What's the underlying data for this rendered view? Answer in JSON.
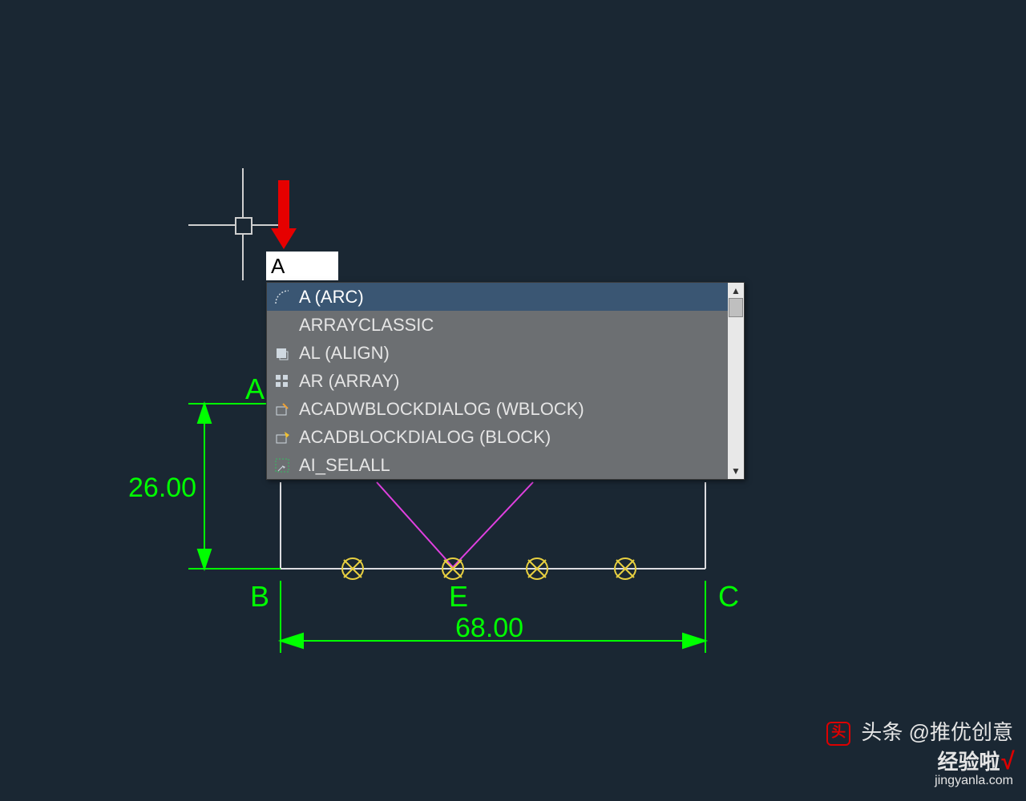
{
  "command_input": "A",
  "dropdown": {
    "items": [
      {
        "label": "A (ARC)",
        "icon": "arc-icon",
        "selected": true
      },
      {
        "label": "ARRAYCLASSIC",
        "icon": "",
        "selected": false
      },
      {
        "label": "AL (ALIGN)",
        "icon": "align-icon",
        "selected": false
      },
      {
        "label": "AR (ARRAY)",
        "icon": "array-icon",
        "selected": false
      },
      {
        "label": "ACADWBLOCKDIALOG (WBLOCK)",
        "icon": "wblock-icon",
        "selected": false
      },
      {
        "label": "ACADBLOCKDIALOG (BLOCK)",
        "icon": "block-icon",
        "selected": false
      },
      {
        "label": "AI_SELALL",
        "icon": "selall-icon",
        "selected": false
      }
    ]
  },
  "drawing": {
    "points": {
      "A": "A",
      "B": "B",
      "C": "C",
      "E": "E"
    },
    "dimensions": {
      "vertical": "26.00",
      "horizontal": "68.00"
    }
  },
  "watermark_main": "推优创意",
  "watermark_footer": {
    "line1_prefix": "头条",
    "line1_handle": "@推优创意",
    "brand": "经验啦",
    "url": "jingyanla.com"
  }
}
